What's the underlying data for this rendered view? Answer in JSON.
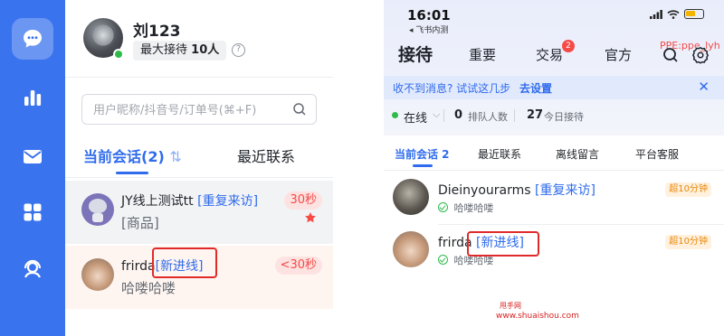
{
  "desktop": {
    "rail": [
      {
        "icon": "chat-bubble-icon",
        "active": true
      },
      {
        "icon": "bar-chart-icon",
        "active": false
      },
      {
        "icon": "mail-icon",
        "active": false
      },
      {
        "icon": "apps-grid-icon",
        "active": false
      },
      {
        "icon": "agent-headset-icon",
        "active": false
      }
    ],
    "user_name": "刘123",
    "max_label": "最大接待",
    "max_value": "10人",
    "help_icon": "?",
    "search_placeholder": "用户昵称/抖音号/订单号(⌘+F)",
    "tab_current": "当前会话(2)",
    "tab_current_sort": "⇅",
    "tab_recent": "最近联系",
    "conversations": [
      {
        "name": "JY线上测试tt",
        "tag": "[重复来访]",
        "sub": "[商品]",
        "time": "30秒"
      },
      {
        "name": "frirda",
        "tag": "[新进线]",
        "sub": "哈喽哈喽",
        "time": "<30秒"
      }
    ]
  },
  "mobile": {
    "clock": "16:01",
    "carrier": "◂ 飞书内测",
    "tabs": [
      "接待",
      "重要",
      "交易",
      "官方"
    ],
    "trade_badge": "2",
    "env_label": "PPE:ppe_lyh",
    "notice_text": "收不到消息? 试试这几步",
    "notice_link": "去设置",
    "notice_close": "✕",
    "online_label": "在线",
    "online_chevron": "⌵",
    "queue_count": "0",
    "queue_label": "排队人数",
    "today_count": "27",
    "today_label": "今日接待",
    "subtabs": [
      "当前会话 2",
      "最近联系",
      "离线留言",
      "平台客服"
    ],
    "conversations": [
      {
        "name": "Dieinyourarms",
        "tag": "[重复来访]",
        "sub": "哈喽哈喽",
        "badge": "超10分钟"
      },
      {
        "name": "frirda",
        "tag": "[新进线]",
        "sub": "哈喽哈喽",
        "badge": "超10分钟"
      }
    ]
  },
  "watermark": {
    "line1": "甩手网",
    "line2": "www.shuaishou.com"
  },
  "colors": {
    "accent": "#2f6bec",
    "rail": "#3a73ee",
    "alert": "#f54a45",
    "online": "#2fba4c",
    "highlight_box": "#e02a2a"
  }
}
